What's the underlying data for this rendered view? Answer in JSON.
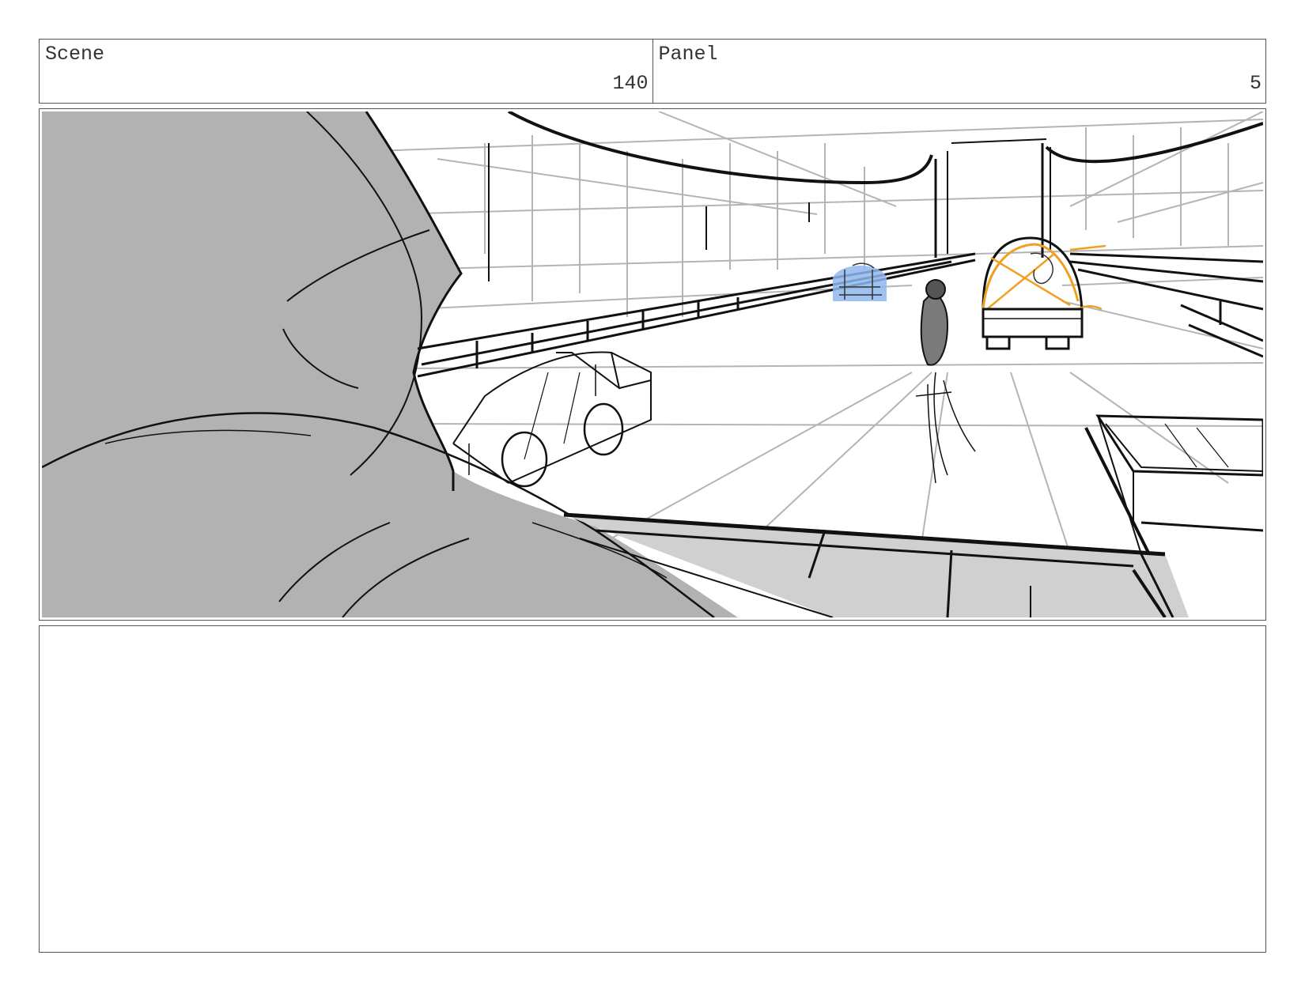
{
  "header": {
    "scene_label": "Scene",
    "scene_value": "140",
    "panel_label": "Panel",
    "panel_value": "5"
  },
  "drawing": {
    "colors": {
      "ink": "#111111",
      "construction": "#b4b4b4",
      "shadow_fill": "#b2b2b2",
      "vehicle_blue": "#8fb7ee",
      "vehicle_orange": "#f0a020"
    }
  },
  "notes": {
    "text": ""
  }
}
